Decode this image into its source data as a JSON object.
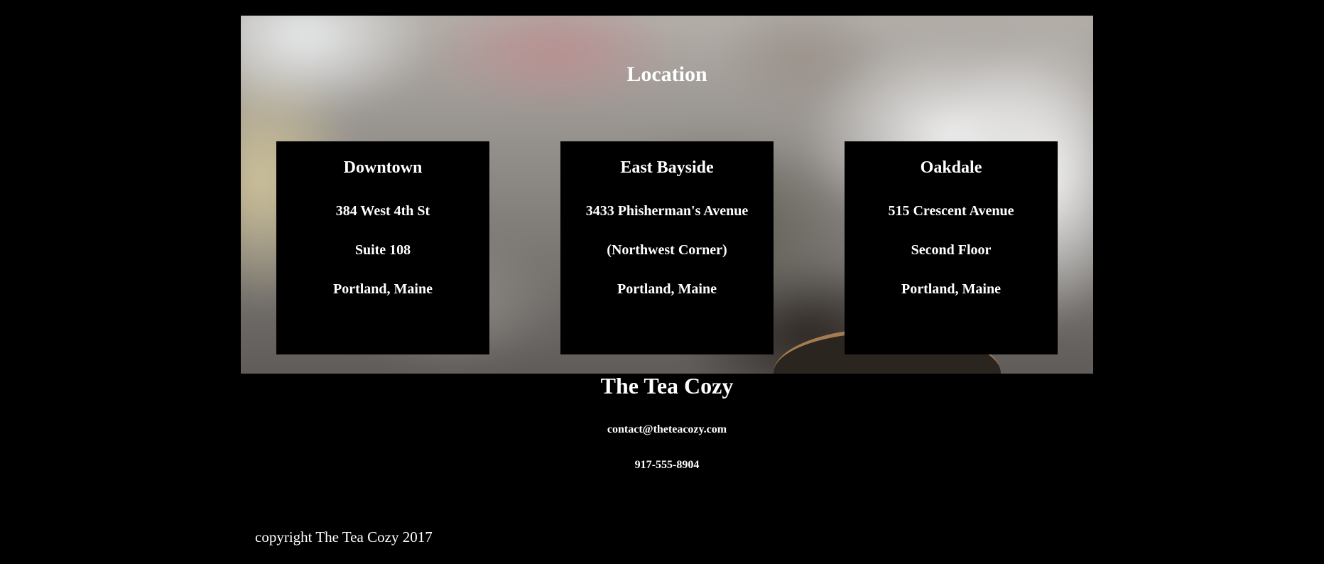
{
  "location": {
    "title": "Location",
    "cards": [
      {
        "name": "Downtown",
        "lines": [
          "384 West 4th St",
          "Suite 108",
          "Portland, Maine"
        ]
      },
      {
        "name": "East Bayside",
        "lines": [
          "3433 Phisherman's Avenue",
          "(Northwest Corner)",
          "Portland, Maine"
        ]
      },
      {
        "name": "Oakdale",
        "lines": [
          "515 Crescent Avenue",
          "Second Floor",
          "Portland, Maine"
        ]
      }
    ]
  },
  "footer": {
    "title": "The Tea Cozy",
    "email": "contact@theteacozy.com",
    "phone": "917-555-8904",
    "copyright": "copyright The Tea Cozy 2017"
  },
  "colors": {
    "background": "#000000",
    "text": "#ffffff"
  }
}
